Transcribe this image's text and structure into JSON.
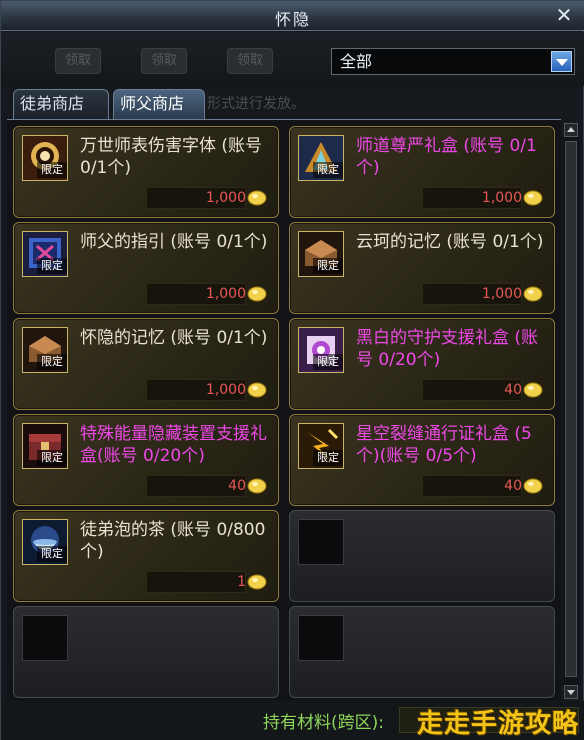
{
  "window": {
    "title": "怀隐"
  },
  "topbar": {
    "ghost_buttons": [
      "领取",
      "领取",
      "领取"
    ]
  },
  "filter": {
    "selected": "全部"
  },
  "tabs": [
    {
      "label": "徒弟商店",
      "active": false
    },
    {
      "label": "师父商店",
      "active": true
    }
  ],
  "notice_text": "形式进行发放。",
  "limited_label": "限定",
  "items": [
    {
      "name": "万世师表伤害字体 (账号 0/1个)",
      "price": "1,000",
      "color": "normal",
      "icon": "scroll-icon"
    },
    {
      "name": "师道尊严礼盒 (账号 0/1个)",
      "price": "1,000",
      "color": "pink",
      "icon": "gift-box-icon"
    },
    {
      "name": "师父的指引 (账号 0/1个)",
      "price": "1,000",
      "color": "normal",
      "icon": "guide-book-icon"
    },
    {
      "name": "云珂的记忆 (账号 0/1个)",
      "price": "1,000",
      "color": "normal",
      "icon": "memory-chest-icon"
    },
    {
      "name": "怀隐的记忆 (账号 0/1个)",
      "price": "1,000",
      "color": "normal",
      "icon": "memory-chest-icon"
    },
    {
      "name": "黑白的守护支援礼盒 (账号 0/20个)",
      "price": "40",
      "color": "pink",
      "icon": "crystal-box-icon"
    },
    {
      "name": "特殊能量隐藏装置支援礼盒(账号 0/20个)",
      "price": "40",
      "color": "pink",
      "icon": "device-chest-icon"
    },
    {
      "name": "星空裂缝通行证礼盒 (5个)(账号 0/5个)",
      "price": "40",
      "color": "pink",
      "icon": "pass-ticket-icon"
    },
    {
      "name": "徒弟泡的茶 (账号 0/800个)",
      "price": "1",
      "color": "normal",
      "icon": "tea-cup-icon"
    }
  ],
  "footer": {
    "materials_label": "持有材料(跨区):",
    "watermark": "走走手游攻略"
  },
  "colors": {
    "accent_gold": "#8a7a3c",
    "price_red": "#e85858",
    "item_pink": "#f048e8",
    "material_green": "#8ed65a"
  }
}
